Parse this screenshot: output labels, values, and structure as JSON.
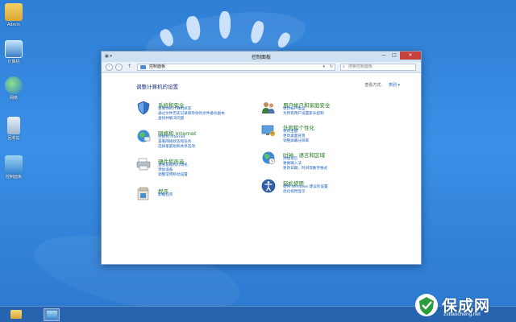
{
  "desktop": {
    "icons": [
      {
        "label": "Admin",
        "icon": "user-folder-icon"
      },
      {
        "label": "计算机",
        "icon": "computer-icon"
      },
      {
        "label": "网络",
        "icon": "network-icon"
      },
      {
        "label": "回收站",
        "icon": "recycle-bin-icon"
      },
      {
        "label": "控制面板",
        "icon": "control-panel-icon"
      }
    ]
  },
  "window": {
    "title": "控制面板",
    "controls": {
      "minimize": "—",
      "maximize": "□",
      "close": "✕"
    },
    "address": {
      "path": "控制面板",
      "search_placeholder": "搜索控制面板"
    },
    "heading": "调整计算机的设置",
    "view_by_label": "查看方式:",
    "view_by_value": "类别 ▾",
    "categories": [
      {
        "title": "系统和安全",
        "icon": "shield-icon",
        "links": [
          "查看你的计算机状态",
          "通过文件历史记录保存你的文件备份副本",
          "查找并解决问题"
        ]
      },
      {
        "title": "网络和 Internet",
        "icon": "network-globe-icon",
        "links": [
          "连接到 Internet",
          "查看网络状态和任务",
          "选择家庭组和共享选项"
        ]
      },
      {
        "title": "硬件和声音",
        "icon": "printer-icon",
        "links": [
          "查看设备和打印机",
          "添加设备",
          "调整常用移动设置"
        ]
      },
      {
        "title": "程序",
        "icon": "programs-icon",
        "links": [
          "卸载程序"
        ]
      },
      {
        "title": "用户帐户和家庭安全",
        "icon": "users-icon",
        "links": [
          "更改帐户类型",
          "为所有用户设置家长控制"
        ]
      },
      {
        "title": "外观和个性化",
        "icon": "appearance-icon",
        "links": [
          "更改主题",
          "更改桌面背景",
          "调整屏幕分辨率"
        ]
      },
      {
        "title": "时钟、语言和区域",
        "icon": "clock-globe-icon",
        "links": [
          "添加语言",
          "更换输入法",
          "更改日期、时间或数字格式"
        ]
      },
      {
        "title": "轻松使用",
        "icon": "accessibility-icon",
        "links": [
          "使用 Windows 建议的设置",
          "优化视觉显示"
        ]
      }
    ]
  },
  "taskbar": {
    "items": [
      {
        "icon": "file-explorer-icon"
      },
      {
        "icon": "control-panel-icon",
        "active": true
      }
    ]
  },
  "watermark": {
    "brand": "保成网",
    "url": "zsbaocheng.net"
  },
  "colors": {
    "desktop_bg": "#2f7fd6",
    "category_title": "#1e7a1e",
    "link": "#1a5fc0",
    "heading": "#1e3287",
    "close_button": "#c7413a"
  }
}
